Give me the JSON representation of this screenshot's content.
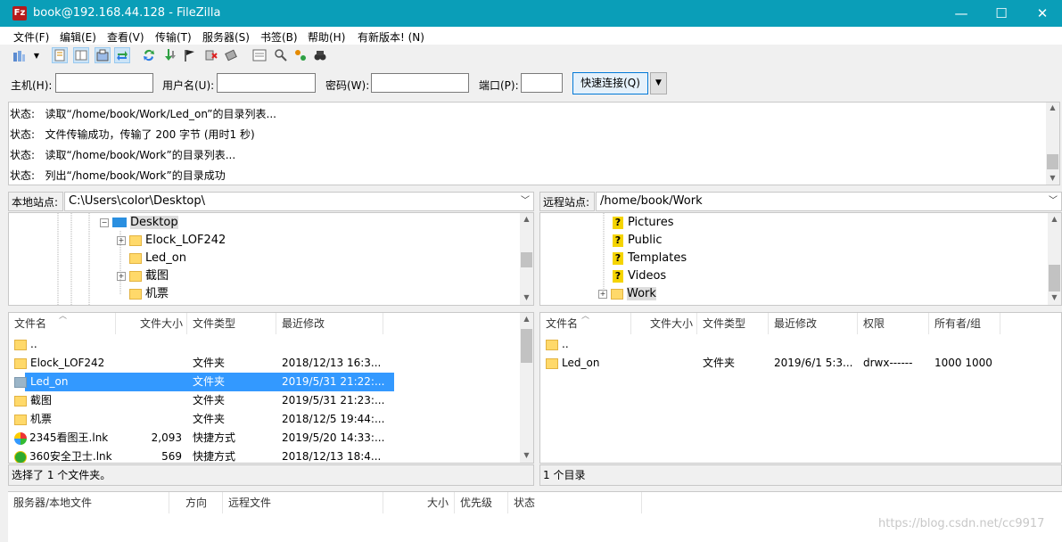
{
  "window": {
    "title": "book@192.168.44.128 - FileZilla",
    "app_icon": "Fz",
    "minimize": "—",
    "maximize": "☐",
    "close": "✕"
  },
  "menu": [
    "文件(F)",
    "编辑(E)",
    "查看(V)",
    "传输(T)",
    "服务器(S)",
    "书签(B)",
    "帮助(H)",
    "有新版本! (N)"
  ],
  "quickconnect": {
    "host_label": "主机(H):",
    "user_label": "用户名(U):",
    "pass_label": "密码(W):",
    "port_label": "端口(P):",
    "button": "快速连接(Q)",
    "dropdown": "▼"
  },
  "log": [
    {
      "prefix": "状态:",
      "text": "读取“/home/book/Work/Led_on”的目录列表..."
    },
    {
      "prefix": "状态:",
      "text": "文件传输成功，传输了 200 字节 (用时1 秒)"
    },
    {
      "prefix": "状态:",
      "text": "读取“/home/book/Work”的目录列表..."
    },
    {
      "prefix": "状态:",
      "text": "列出“/home/book/Work”的目录成功"
    }
  ],
  "local": {
    "site_label": "本地站点:",
    "path": "C:\\Users\\color\\Desktop\\",
    "tree": [
      "Desktop",
      "Elock_LOF242",
      "Led_on",
      "截图",
      "机票"
    ],
    "headers": [
      "文件名",
      "文件大小",
      "文件类型",
      "最近修改"
    ],
    "files": [
      {
        "name": "..",
        "size": "",
        "type": "",
        "modified": ""
      },
      {
        "name": "Elock_LOF242",
        "size": "",
        "type": "文件夹",
        "modified": "2018/12/13 16:3..."
      },
      {
        "name": "Led_on",
        "size": "",
        "type": "文件夹",
        "modified": "2019/5/31 21:22:..."
      },
      {
        "name": "截图",
        "size": "",
        "type": "文件夹",
        "modified": "2019/5/31 21:23:..."
      },
      {
        "name": "机票",
        "size": "",
        "type": "文件夹",
        "modified": "2018/12/5 19:44:..."
      },
      {
        "name": "2345看图王.lnk",
        "size": "2,093",
        "type": "快捷方式",
        "modified": "2019/5/20 14:33:..."
      },
      {
        "name": "360安全卫士.lnk",
        "size": "569",
        "type": "快捷方式",
        "modified": "2018/12/13 18:4..."
      }
    ],
    "status": "选择了 1 个文件夹。"
  },
  "remote": {
    "site_label": "远程站点:",
    "path": "/home/book/Work",
    "tree": [
      "Pictures",
      "Public",
      "Templates",
      "Videos",
      "Work"
    ],
    "headers": [
      "文件名",
      "文件大小",
      "文件类型",
      "最近修改",
      "权限",
      "所有者/组"
    ],
    "files": [
      {
        "name": "..",
        "size": "",
        "type": "",
        "modified": "",
        "perm": "",
        "owner": ""
      },
      {
        "name": "Led_on",
        "size": "",
        "type": "文件夹",
        "modified": "2019/6/1 5:3...",
        "perm": "drwx------",
        "owner": "1000 1000"
      }
    ],
    "status": "1 个目录"
  },
  "queue": {
    "headers": [
      "服务器/本地文件",
      "方向",
      "远程文件",
      "大小",
      "优先级",
      "状态"
    ]
  },
  "watermark": "https://blog.csdn.net/cc9917",
  "colors": {
    "titlebar": "#0a9eb8",
    "selection": "#3399ff",
    "folder": "#ffd96a"
  }
}
